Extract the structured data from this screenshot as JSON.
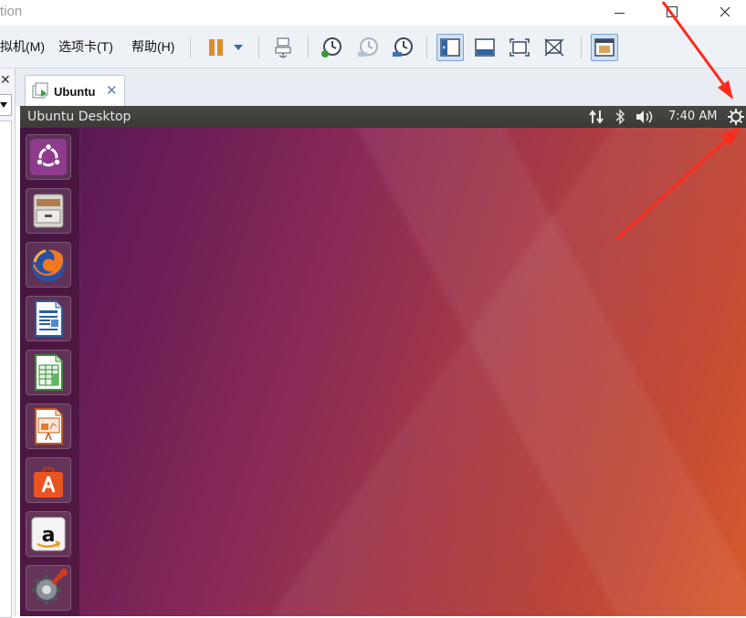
{
  "window": {
    "title_fragment": "tion"
  },
  "menus": {
    "vm": "拟机(M)",
    "tabs": "选项卡(T)",
    "help": "帮助(H)"
  },
  "tab": {
    "label": "Ubuntu",
    "close_glyph": "✕"
  },
  "library": {
    "close_glyph": "✕"
  },
  "guest": {
    "topbar_title": "Ubuntu Desktop",
    "time": "7:40 AM"
  },
  "launcher_items": [
    "ubuntu-dash-icon",
    "files-icon",
    "firefox-icon",
    "libreoffice-writer-icon",
    "libreoffice-calc-icon",
    "libreoffice-impress-icon",
    "ubuntu-software-icon",
    "amazon-icon",
    "system-settings-icon"
  ],
  "colors": {
    "annotation_arrow": "#ff2a1a",
    "ubuntu_orange": "#e95420"
  }
}
